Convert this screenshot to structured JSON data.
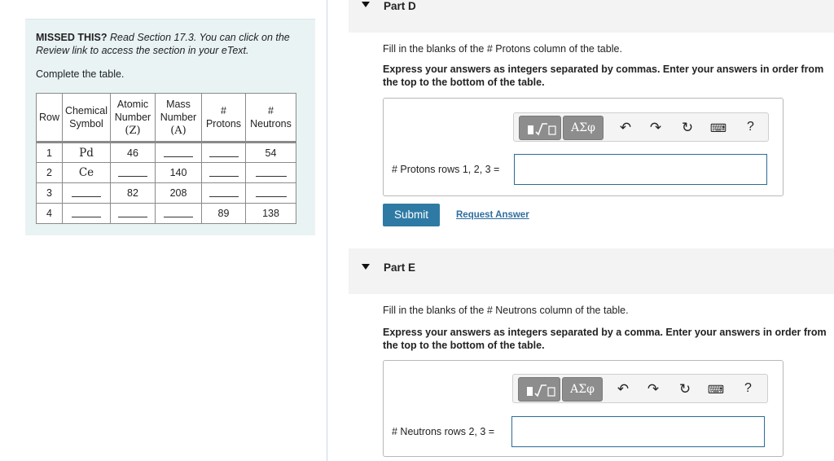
{
  "left": {
    "missed_bold": "MISSED THIS?",
    "missed_italic": "Read Section 17.3. You can click on the Review link to access the section in your eText.",
    "complete": "Complete the table.",
    "headers": {
      "row": "Row",
      "symbol_1": "Chemical",
      "symbol_2": "Symbol",
      "atomic_1": "Atomic",
      "atomic_2": "Number",
      "atomic_3": "(Z)",
      "mass_1": "Mass",
      "mass_2": "Number",
      "mass_3": "(A)",
      "protons_1": "#",
      "protons_2": "Protons",
      "neutrons_1": "#",
      "neutrons_2": "Neutrons"
    },
    "rows": [
      {
        "row": "1",
        "symbol": "Pd",
        "atomic": "46",
        "mass": "",
        "protons": "",
        "neutrons": "54"
      },
      {
        "row": "2",
        "symbol": "Ce",
        "atomic": "",
        "mass": "140",
        "protons": "",
        "neutrons": ""
      },
      {
        "row": "3",
        "symbol": "",
        "atomic": "82",
        "mass": "208",
        "protons": "",
        "neutrons": ""
      },
      {
        "row": "4",
        "symbol": "",
        "atomic": "",
        "mass": "",
        "protons": "89",
        "neutrons": "138"
      }
    ]
  },
  "partD": {
    "title": "Part D",
    "instruction": "Fill in the blanks of the # Protons column of the table.",
    "bold_instruction": "Express your answers as integers separated by commas. Enter your answers in order from the top to the bottom of the table.",
    "toolbar": {
      "greek": "ΑΣφ",
      "help": "?"
    },
    "field_label": "# Protons rows 1, 2, 3 =",
    "field_value": "",
    "submit": "Submit",
    "request": "Request Answer"
  },
  "partE": {
    "title": "Part E",
    "instruction": "Fill in the blanks of the # Neutrons column of the table.",
    "bold_instruction": "Express your answers as integers separated by a comma. Enter your answers in order from the top to the bottom of the table.",
    "toolbar": {
      "greek": "ΑΣφ",
      "help": "?"
    },
    "field_label": "# Neutrons rows  2, 3 =",
    "field_value": ""
  },
  "colors": {
    "accent": "#2e7aa5",
    "panel": "#e9f3f4",
    "link": "#2e6e9e"
  }
}
